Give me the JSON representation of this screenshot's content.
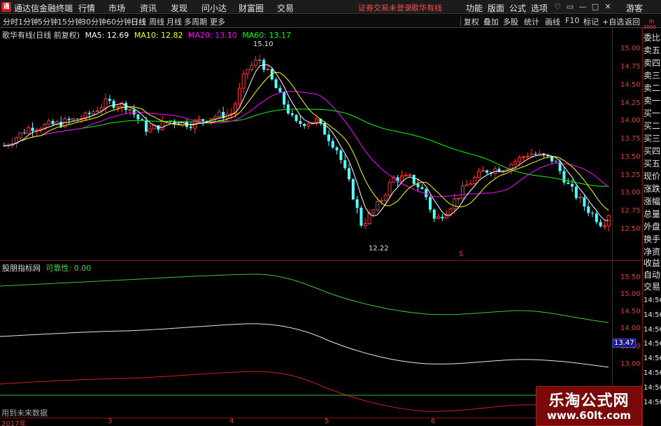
{
  "menubar": {
    "app_title": "通达信金融终端",
    "items": [
      "行情",
      "市场",
      "资讯",
      "发现",
      "问小达",
      "财富圈",
      "交易"
    ],
    "warning": "证券交易未登录",
    "stock": "歌华有线",
    "right_items": [
      "功能",
      "版面",
      "公式",
      "选项"
    ],
    "guest": "游客",
    "win_buttons": [
      "♡",
      "▭",
      "—",
      "□",
      "✕"
    ]
  },
  "toolbar": {
    "periods": [
      "分时",
      "1分钟",
      "5分钟",
      "15分钟",
      "30分钟",
      "60分钟",
      "日线",
      "周线",
      "月线",
      "多周期",
      "更多"
    ],
    "active_period": "日线",
    "right": [
      "复权",
      "叠加",
      "多股",
      "统计",
      "画线",
      "F10",
      "标记",
      "+自选",
      "返回"
    ]
  },
  "main_legend": {
    "title": "歌华有线(日线 前复权)",
    "ma5": "MA5: 12.69",
    "ma10": "MA10: 12.82",
    "ma20": "MA20: 13.10",
    "ma60": "MA60: 13.17"
  },
  "price_axis": [
    "15.00",
    "14.75",
    "14.50",
    "14.25",
    "14.00",
    "13.75",
    "13.50",
    "13.25",
    "13.00",
    "12.75",
    "12.50"
  ],
  "annotations": {
    "high": "15.10",
    "low": "12.22",
    "marker": "S"
  },
  "indicator_legend": {
    "name": "股朋指标网",
    "label": "可靠性: 0.00"
  },
  "indicator_axis": [
    "15.50",
    "15.00",
    "14.50",
    "14.00",
    "13.50",
    "13.00"
  ],
  "indicator_value_tag": "13.47",
  "indicator_note": "用到未来数据",
  "time_axis": [
    "2017年",
    "3",
    "4",
    "5",
    "6"
  ],
  "side_panel": {
    "top": [
      "委比",
      "卖五",
      "卖四",
      "卖三",
      "卖二",
      "卖一",
      "买一",
      "买二",
      "买三",
      "买四",
      "买五",
      "现价",
      "涨跌",
      "涨幅",
      "总量",
      "外盘",
      "换手",
      "净资",
      "收益"
    ],
    "bottom": [
      "自动",
      "交易"
    ],
    "times": [
      "14:56",
      "14:56",
      "14:56",
      "14:56",
      "14:56",
      "14:56",
      "14:56",
      "14:56"
    ],
    "mini_top": "th",
    "mini_bot": "1000"
  },
  "watermark": {
    "line1": "乐淘公式网",
    "line2": "www.60lt.com"
  },
  "colors": {
    "up": "#ff3232",
    "down": "#54ffff",
    "ma5": "#ffffff",
    "ma10": "#ffff00",
    "ma20": "#ff00ff",
    "ma60": "#00ff00",
    "grid": "#8b1010"
  }
}
